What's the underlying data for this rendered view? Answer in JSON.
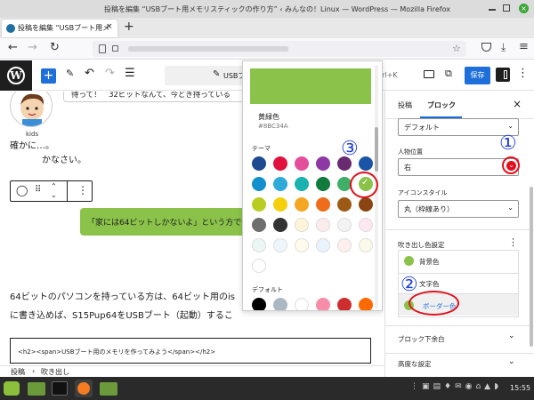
{
  "window": {
    "title": "投稿を編集 “USBブート用メモリスティックの作り方” ‹ みんなの！Linux — WordPress — Mozilla Firefox"
  },
  "browser": {
    "tab_title": "投稿を編集 “USBブート用メ",
    "new_tab": "+"
  },
  "wp": {
    "title_pill": "USBブ",
    "shortcut": "trl+K",
    "save_label": "保存"
  },
  "content": {
    "bubble_top": "待って！　32ビットなんて、今どき持っている",
    "avatar_name": "kids",
    "para1": "確かに…。",
    "para1b": "かなさい。",
    "green_bubble": "「家には64ビットしかないよ」という方で",
    "para2": "64ビットのパソコンを持っている方は、64ビット用のis",
    "para3": "に書き込めば、S15Pup64をUSBブート（起動）するこ",
    "code": "<h2><span>USBブート用のメモリを作ってみよう</span></h2>",
    "breadcrumb_1": "投稿",
    "breadcrumb_sep": "›",
    "breadcrumb_2": "吹き出し"
  },
  "color_picker": {
    "selected_name": "黄緑色",
    "selected_hex": "#8BC34A",
    "theme_label": "テーマ",
    "default_label": "デフォルト",
    "theme_colors": [
      "#1e4a8f",
      "#e0103f",
      "#e44f9c",
      "#8c39a4",
      "#6a2a6f",
      "#1a54a6",
      "#138fcd",
      "#2eaad8",
      "#1bb1ae",
      "#127a3c",
      "#3fae69",
      "#8bc34a",
      "#b9cc22",
      "#f4cf0b",
      "#f5a623",
      "#ef6c1a",
      "#9c5a14",
      "#8b4513",
      "#6e6e6e",
      "#333333",
      "#fdf4d8",
      "#fbecec",
      "#f3f3f3",
      "#fde7f0",
      "#eaf7f5",
      "#eef5fb",
      "#fffaea",
      "#e8f3fd",
      "#fdf0ec",
      "#fbf9e8",
      "#ffffff"
    ],
    "default_colors": [
      "#000000",
      "#abb8c3",
      "#ffffff",
      "#f78da7",
      "#cf2e2e",
      "#ff6900"
    ]
  },
  "sidebar": {
    "tab_post": "投稿",
    "tab_block": "ブロック",
    "style_select": "デフォルト",
    "person_pos_label": "人物位置",
    "person_pos_value": "右",
    "icon_style_label": "アイコンスタイル",
    "icon_style_value": "丸（枠線あり）",
    "bubble_color_label": "吹き出し色設定",
    "bg_color": "背景色",
    "text_color": "文字色",
    "border_color": "ボーダー色",
    "bottom_margin": "ブロック下余白",
    "advanced": "高度な設定"
  },
  "annotations": {
    "one": "①",
    "two": "②",
    "three": "③"
  },
  "taskbar": {
    "clock": "15:55"
  }
}
